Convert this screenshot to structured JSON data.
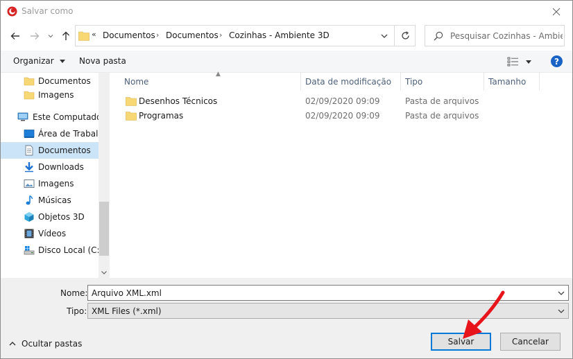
{
  "window": {
    "title": "Salvar como"
  },
  "address": {
    "overflow": "«",
    "crumbs": [
      "Documentos",
      "Documentos",
      "Cozinhas - Ambiente 3D"
    ]
  },
  "search": {
    "placeholder": "Pesquisar Cozinhas - Ambie..."
  },
  "toolbar": {
    "organize_label": "Organizar",
    "new_folder_label": "Nova pasta",
    "help_label": "?"
  },
  "navpane": {
    "items": [
      {
        "label": "Documentos",
        "icon": "folder-icon"
      },
      {
        "label": "Imagens",
        "icon": "folder-icon"
      },
      {
        "label": "Este Computador",
        "icon": "computer-icon"
      },
      {
        "label": "Área de Trabalho",
        "icon": "desktop-icon"
      },
      {
        "label": "Documentos",
        "icon": "documents-icon",
        "selected": true
      },
      {
        "label": "Downloads",
        "icon": "download-icon"
      },
      {
        "label": "Imagens",
        "icon": "pictures-icon"
      },
      {
        "label": "Músicas",
        "icon": "music-icon"
      },
      {
        "label": "Objetos 3D",
        "icon": "cube-icon"
      },
      {
        "label": "Vídeos",
        "icon": "video-icon"
      },
      {
        "label": "Disco Local (C:)",
        "icon": "drive-icon"
      }
    ]
  },
  "filelist": {
    "columns": {
      "name": "Nome",
      "modified": "Data de modificação",
      "type": "Tipo",
      "size": "Tamanho"
    },
    "rows": [
      {
        "name": "Desenhos Técnicos",
        "modified": "02/09/2020 09:09",
        "type": "Pasta de arquivos"
      },
      {
        "name": "Programas",
        "modified": "02/09/2020 09:09",
        "type": "Pasta de arquivos"
      }
    ]
  },
  "form": {
    "name_label": "Nome:",
    "name_value": "Arquivo XML.xml",
    "type_label": "Tipo:",
    "type_value": "XML Files (*.xml)"
  },
  "footer": {
    "hide_folders_label": "Ocultar pastas",
    "save_label": "Salvar",
    "cancel_label": "Cancelar"
  },
  "colors": {
    "accent": "#0078d7",
    "selection": "#cce4f7",
    "folder": "#f8d775",
    "annotation_arrow": "#e8141b"
  }
}
